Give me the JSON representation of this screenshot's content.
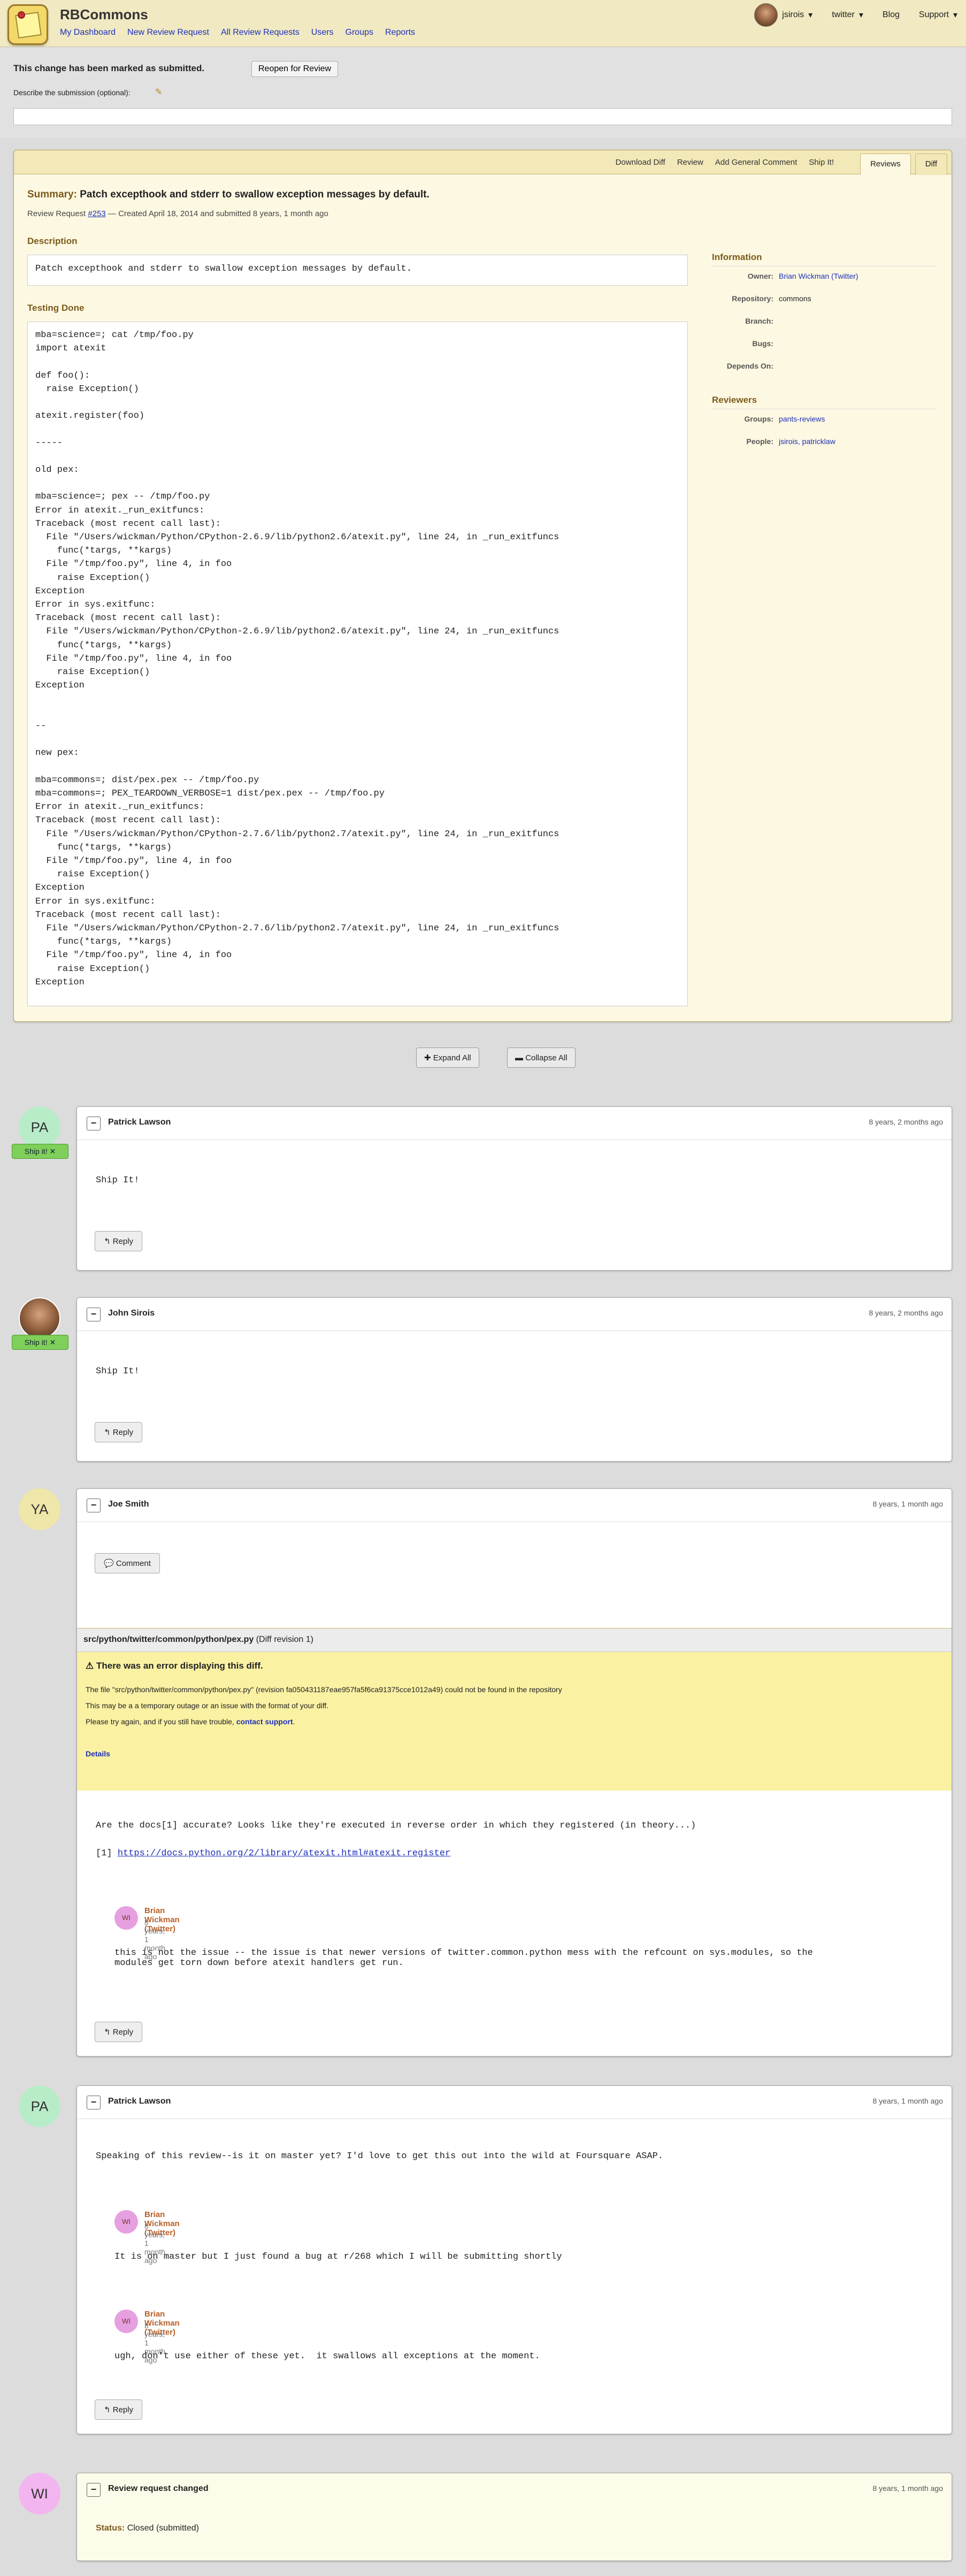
{
  "header": {
    "app_name": "RBCommons",
    "nav": [
      "My Dashboard",
      "New Review Request",
      "All Review Requests",
      "Users",
      "Groups",
      "Reports"
    ],
    "user": "jsirois",
    "menus": [
      "twitter",
      "Blog",
      "Support"
    ]
  },
  "banner": {
    "message": "This change has been marked as submitted.",
    "reopen": "Reopen for Review",
    "describe": "Describe the submission (optional):"
  },
  "review_request": {
    "actions": [
      "Download Diff",
      "Review",
      "Add General Comment",
      "Ship It!"
    ],
    "tabs": [
      "Reviews",
      "Diff"
    ],
    "summary_label": "Summary:",
    "summary": "Patch excepthook and stderr to swallow exception messages by default.",
    "meta_prefix": "Review Request ",
    "meta_link": "#253",
    "meta_suffix": " — Created April 18, 2014 and submitted 8 years, 1 month ago",
    "description_label": "Description",
    "description": "Patch excepthook and stderr to swallow exception messages by default.",
    "testing_label": "Testing Done",
    "testing": "mba=science=; cat /tmp/foo.py\nimport atexit\n\ndef foo():\n  raise Exception()\n\natexit.register(foo)\n\n-----\n\nold pex:\n\nmba=science=; pex -- /tmp/foo.py\nError in atexit._run_exitfuncs:\nTraceback (most recent call last):\n  File \"/Users/wickman/Python/CPython-2.6.9/lib/python2.6/atexit.py\", line 24, in _run_exitfuncs\n    func(*targs, **kargs)\n  File \"/tmp/foo.py\", line 4, in foo\n    raise Exception()\nException\nError in sys.exitfunc:\nTraceback (most recent call last):\n  File \"/Users/wickman/Python/CPython-2.6.9/lib/python2.6/atexit.py\", line 24, in _run_exitfuncs\n    func(*targs, **kargs)\n  File \"/tmp/foo.py\", line 4, in foo\n    raise Exception()\nException\n\n\n--\n\nnew pex:\n\nmba=commons=; dist/pex.pex -- /tmp/foo.py\nmba=commons=; PEX_TEARDOWN_VERBOSE=1 dist/pex.pex -- /tmp/foo.py\nError in atexit._run_exitfuncs:\nTraceback (most recent call last):\n  File \"/Users/wickman/Python/CPython-2.7.6/lib/python2.7/atexit.py\", line 24, in _run_exitfuncs\n    func(*targs, **kargs)\n  File \"/tmp/foo.py\", line 4, in foo\n    raise Exception()\nException\nError in sys.exitfunc:\nTraceback (most recent call last):\n  File \"/Users/wickman/Python/CPython-2.7.6/lib/python2.7/atexit.py\", line 24, in _run_exitfuncs\n    func(*targs, **kargs)\n  File \"/tmp/foo.py\", line 4, in foo\n    raise Exception()\nException",
    "info": {
      "heading": "Information",
      "owner_k": "Owner:",
      "owner": "Brian Wickman (Twitter)",
      "repo_k": "Repository:",
      "repo": "commons",
      "branch_k": "Branch:",
      "bugs_k": "Bugs:",
      "depends_k": "Depends On:"
    },
    "reviewers": {
      "heading": "Reviewers",
      "groups_k": "Groups:",
      "groups": "pants-reviews",
      "people_k": "People:",
      "people": "jsirois, patricklaw"
    }
  },
  "controls": {
    "expand": "Expand All",
    "collapse": "Collapse All"
  },
  "reviews": [
    {
      "initials": "PA",
      "name": "Patrick Lawson",
      "time": "8 years, 2 months ago",
      "ship": "Ship it!",
      "body": "Ship It!",
      "reply": "Reply"
    },
    {
      "name": "John Sirois",
      "time": "8 years, 2 months ago",
      "ship": "Ship it!",
      "body": "Ship It!",
      "reply": "Reply"
    },
    {
      "initials": "YA",
      "name": "Joe Smith",
      "time": "8 years, 1 month ago",
      "comment_btn": "Comment",
      "diff_file": "src/python/twitter/common/python/pex.py",
      "diff_rev": "(Diff revision 1)",
      "err_title": "There was an error displaying this diff.",
      "err1": "The file \"src/python/twitter/common/python/pex.py\" (revision fa050431187eae957fa5f6ca91375cce1012a49) could not be found in the repository",
      "err2": "This may be a a temporary outage or an issue with the format of your diff.",
      "err3": "Please try again, and if you still have trouble, ",
      "err3_link": "contact support",
      "err3_end": ".",
      "details": "Details",
      "comment": "Are the docs[1] accurate? Looks like they're executed in reverse order in which they registered (in theory...)",
      "ref": "[1] ",
      "ref_link": "https://docs.python.org/2/library/atexit.html#atexit.register",
      "reply_name": "Brian Wickman (Twitter)",
      "reply_time": "8 years, 1 month ago",
      "reply_initials": "WI",
      "reply_text": "this is not the issue -- the issue is that newer versions of twitter.common.python mess with the refcount on sys.modules, so the\nmodules get torn down before atexit handlers get run.",
      "reply": "Reply"
    },
    {
      "initials": "PA",
      "name": "Patrick Lawson",
      "time": "8 years, 1 month ago",
      "body": "Speaking of this review--is it on master yet?  I'd love to get this out into the wild at Foursquare ASAP.",
      "r1_name": "Brian Wickman (Twitter)",
      "r1_time": "8 years, 1 month ago",
      "r1_text": "It is on master but I just found a bug at r/268 which I will be submitting shortly",
      "r2_name": "Brian Wickman (Twitter)",
      "r2_time": "8 years, 1 month ago",
      "r2_text": "ugh, don't use either of these yet.  it swallows all exceptions at the moment.",
      "r_initials": "WI",
      "reply": "Reply"
    },
    {
      "initials": "WI",
      "name": "Review request changed",
      "time": "8 years, 1 month ago",
      "status_k": "Status:",
      "status": "Closed (submitted)"
    }
  ],
  "colors": {
    "header": "#f0e9c2",
    "review_box": "#fdf8e2",
    "ship_it": "#7fd05a",
    "error_bg": "#faf1a3",
    "avatar_pa": "#b8ecc9",
    "avatar_ya": "#efe6a9",
    "avatar_wi": "#f2b5ef"
  }
}
